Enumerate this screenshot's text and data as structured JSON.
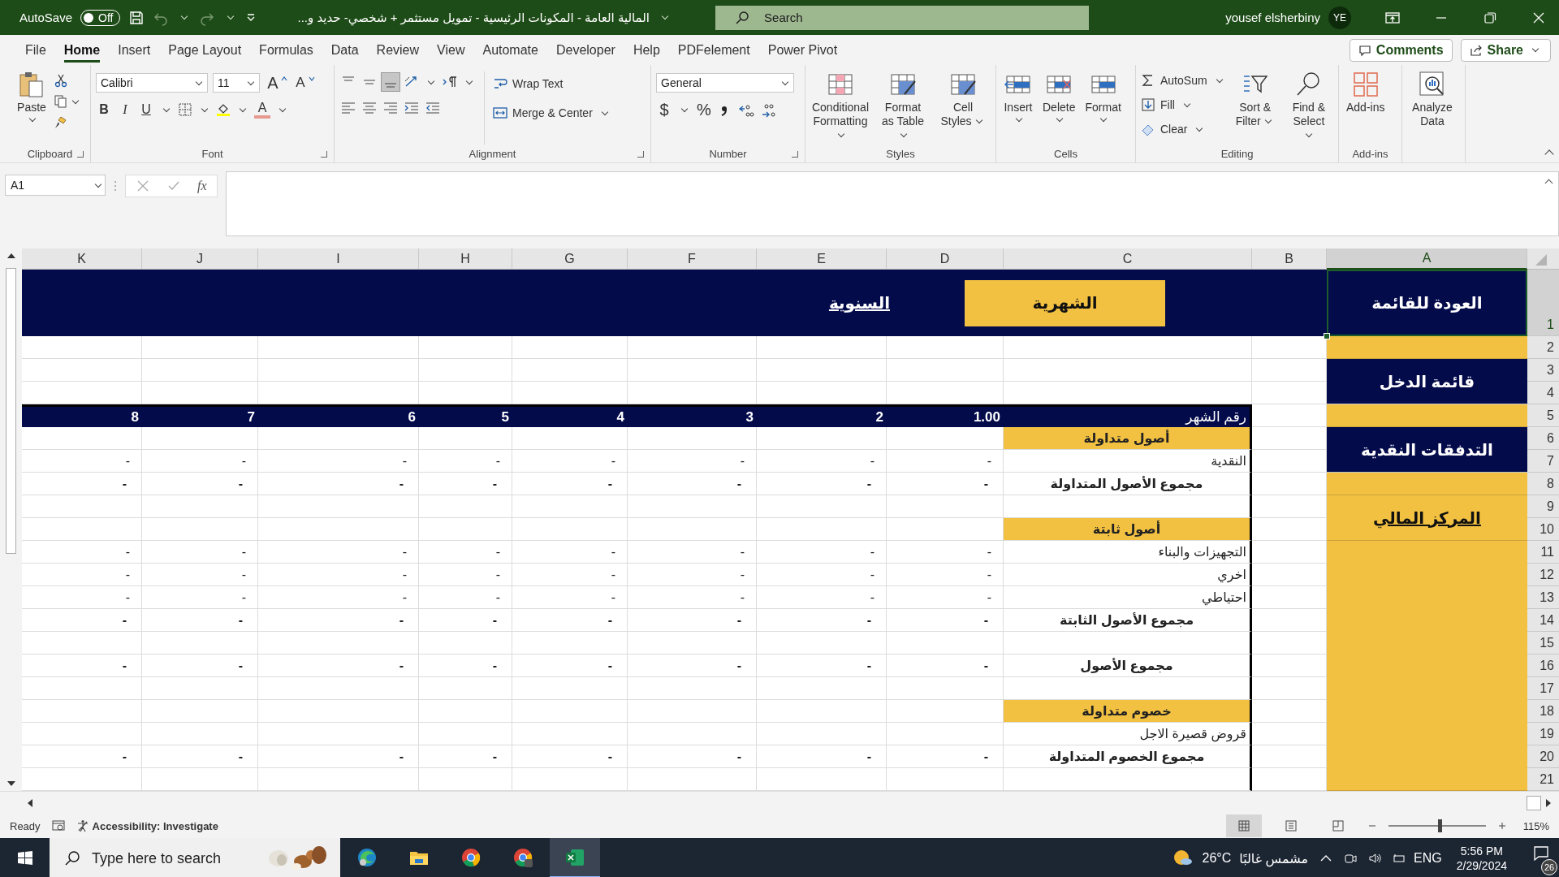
{
  "title_bar": {
    "autosave_label": "AutoSave",
    "autosave": {
      "on": false,
      "label": "Off"
    },
    "title": "المالية العامة - المكونات الرئيسية - تمويل مستثمر + شخصي- حديد و...",
    "search_placeholder": "Search",
    "user_name": "yousef elsherbiny",
    "user_initials": "YE"
  },
  "menu_tabs": [
    {
      "label": "File",
      "selected": false
    },
    {
      "label": "Home",
      "selected": true
    },
    {
      "label": "Insert",
      "selected": false
    },
    {
      "label": "Page Layout",
      "selected": false
    },
    {
      "label": "Formulas",
      "selected": false
    },
    {
      "label": "Data",
      "selected": false
    },
    {
      "label": "Review",
      "selected": false
    },
    {
      "label": "View",
      "selected": false
    },
    {
      "label": "Automate",
      "selected": false
    },
    {
      "label": "Developer",
      "selected": false
    },
    {
      "label": "Help",
      "selected": false
    },
    {
      "label": "PDFelement",
      "selected": false
    },
    {
      "label": "Power Pivot",
      "selected": false
    }
  ],
  "comments_button": "Comments",
  "share_button": "Share",
  "ribbon": {
    "clipboard": {
      "label": "Clipboard",
      "paste": "Paste"
    },
    "font": {
      "label": "Font",
      "font_name": "Calibri",
      "font_size": "11",
      "grow": "A",
      "shrink": "A",
      "bold": "B",
      "italic": "I",
      "underline": "U",
      "font_color": "A"
    },
    "alignment": {
      "label": "Alignment",
      "vertical_buttons": [
        {
          "selected": false
        },
        {
          "selected": false
        },
        {
          "selected": true
        }
      ],
      "wrap_text": "Wrap Text",
      "merge_center": "Merge & Center"
    },
    "number": {
      "label": "Number",
      "format": "General",
      "currency": "$",
      "percent": "%"
    },
    "styles": {
      "label": "Styles",
      "buttons": [
        "Conditional Formatting",
        "Format as Table",
        "Cell Styles"
      ]
    },
    "cells": {
      "label": "Cells",
      "buttons": [
        "Insert",
        "Delete",
        "Format"
      ]
    },
    "editing": {
      "label": "Editing",
      "autosum": "AutoSum",
      "fill": "Fill",
      "clear": "Clear",
      "sort_filter": "Sort & Filter",
      "find_select": "Find & Select"
    },
    "addins": {
      "label": "Add-ins",
      "button": "Add-ins"
    },
    "analyze": {
      "button": "Analyze Data"
    }
  },
  "formula_bar": {
    "name_box": "A1",
    "function_label": "fx"
  },
  "sheet": {
    "columns": [
      "K",
      "J",
      "I",
      "H",
      "G",
      "F",
      "E",
      "D",
      "C",
      "B",
      "A"
    ],
    "row_numbers": [
      "1",
      "2",
      "3",
      "4",
      "5",
      "6",
      "7",
      "8",
      "9",
      "10",
      "11",
      "12",
      "13",
      "14",
      "15",
      "16",
      "17",
      "18",
      "19",
      "20",
      "21"
    ],
    "nav_items": [
      {
        "kind": "button",
        "label": "العودة للقائمة",
        "selected": true
      },
      {
        "kind": "fill",
        "selected": false
      },
      {
        "kind": "button",
        "label": "قائمة الدخل",
        "selected": false
      },
      {
        "kind": "fill",
        "selected": false
      },
      {
        "kind": "button",
        "label": "التدفقات النقدية",
        "selected": false
      },
      {
        "kind": "fill",
        "selected": false
      },
      {
        "kind": "link",
        "label": "المركز المالي",
        "selected": false
      },
      {
        "kind": "fill",
        "selected": false
      }
    ],
    "period_tabs": [
      {
        "label": "الشهرية",
        "selected": true
      },
      {
        "label": "السنوية",
        "selected": false
      }
    ],
    "table": {
      "header_label": "رقم الشهر",
      "months": [
        "8",
        "7",
        "6",
        "5",
        "4",
        "3",
        "2",
        "1.00"
      ],
      "rows": [
        {
          "kind": "section",
          "label": "أصول متداولة"
        },
        {
          "kind": "item",
          "label": "النقدية",
          "values": [
            "-",
            "-",
            "-",
            "-",
            "-",
            "-",
            "-",
            "-"
          ]
        },
        {
          "kind": "total",
          "label": "مجموع الأصول المتداولة",
          "values": [
            "-",
            "-",
            "-",
            "-",
            "-",
            "-",
            "-",
            "-"
          ]
        },
        {
          "kind": "blank"
        },
        {
          "kind": "section",
          "label": "أصول ثابتة"
        },
        {
          "kind": "item",
          "label": "التجهيزات والبناء",
          "values": [
            "-",
            "-",
            "-",
            "-",
            "-",
            "-",
            "-",
            "-"
          ]
        },
        {
          "kind": "item",
          "label": "اخري",
          "values": [
            "-",
            "-",
            "-",
            "-",
            "-",
            "-",
            "-",
            "-"
          ]
        },
        {
          "kind": "item",
          "label": "احتياطي",
          "values": [
            "-",
            "-",
            "-",
            "-",
            "-",
            "-",
            "-",
            "-"
          ]
        },
        {
          "kind": "total",
          "label": "مجموع الأصول الثابتة",
          "values": [
            "-",
            "-",
            "-",
            "-",
            "-",
            "-",
            "-",
            "-"
          ]
        },
        {
          "kind": "blank"
        },
        {
          "kind": "total",
          "label": "مجموع الأصول",
          "values": [
            "-",
            "-",
            "-",
            "-",
            "-",
            "-",
            "-",
            "-"
          ]
        },
        {
          "kind": "blank"
        },
        {
          "kind": "section",
          "label": "خصوم متداولة"
        },
        {
          "kind": "item",
          "label": "قروض قصيرة الاجل"
        },
        {
          "kind": "total",
          "label": "مجموع الخصوم المتداولة",
          "values": [
            "-",
            "-",
            "-",
            "-",
            "-",
            "-",
            "-",
            "-"
          ]
        },
        {
          "kind": "blank"
        }
      ]
    }
  },
  "status_bar": {
    "ready": "Ready",
    "accessibility": "Accessibility: Investigate",
    "views": [
      {
        "selected": true
      },
      {
        "selected": false
      },
      {
        "selected": false
      }
    ],
    "zoom": {
      "level": 0.53,
      "label": "115%"
    }
  },
  "taskbar": {
    "search_placeholder": "Type here to search",
    "apps": [
      {
        "kind": "edge",
        "selected": false
      },
      {
        "kind": "folder",
        "selected": false
      },
      {
        "kind": "chrome",
        "selected": false
      },
      {
        "kind": "chrome-profile",
        "selected": false
      },
      {
        "kind": "excel",
        "selected": true
      }
    ],
    "temperature": "26°C",
    "weather": "مشمس غالبًا",
    "language": "ENG",
    "time": "5:56 PM",
    "date": "2/29/2024",
    "notifications": "26"
  }
}
